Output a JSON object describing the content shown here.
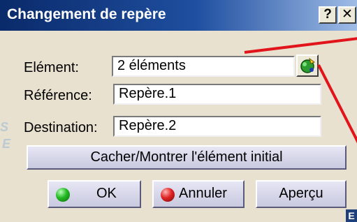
{
  "window": {
    "title": "Changement de repère"
  },
  "titlebar": {
    "help_label": "?",
    "close_label": "✕"
  },
  "form": {
    "element_label": "Elément:",
    "element_value": "2 éléments",
    "reference_label": "Référence:",
    "reference_value": "Repère.1",
    "destination_label": "Destination:",
    "destination_value": "Repère.2"
  },
  "actions": {
    "toggle_label": "Cacher/Montrer l'élément initial",
    "ok_label": "OK",
    "cancel_label": "Annuler",
    "preview_label": "Aperçu"
  },
  "icons": {
    "select_icon": "select-element-icon",
    "ok_icon": "green-dot-icon",
    "cancel_icon": "red-dot-icon"
  },
  "decor": {
    "corner_label": "E"
  },
  "colors": {
    "title_bar": "#0a2a6a",
    "dialog_bg": "#e9e1cf",
    "annotation": "#e0141a"
  }
}
